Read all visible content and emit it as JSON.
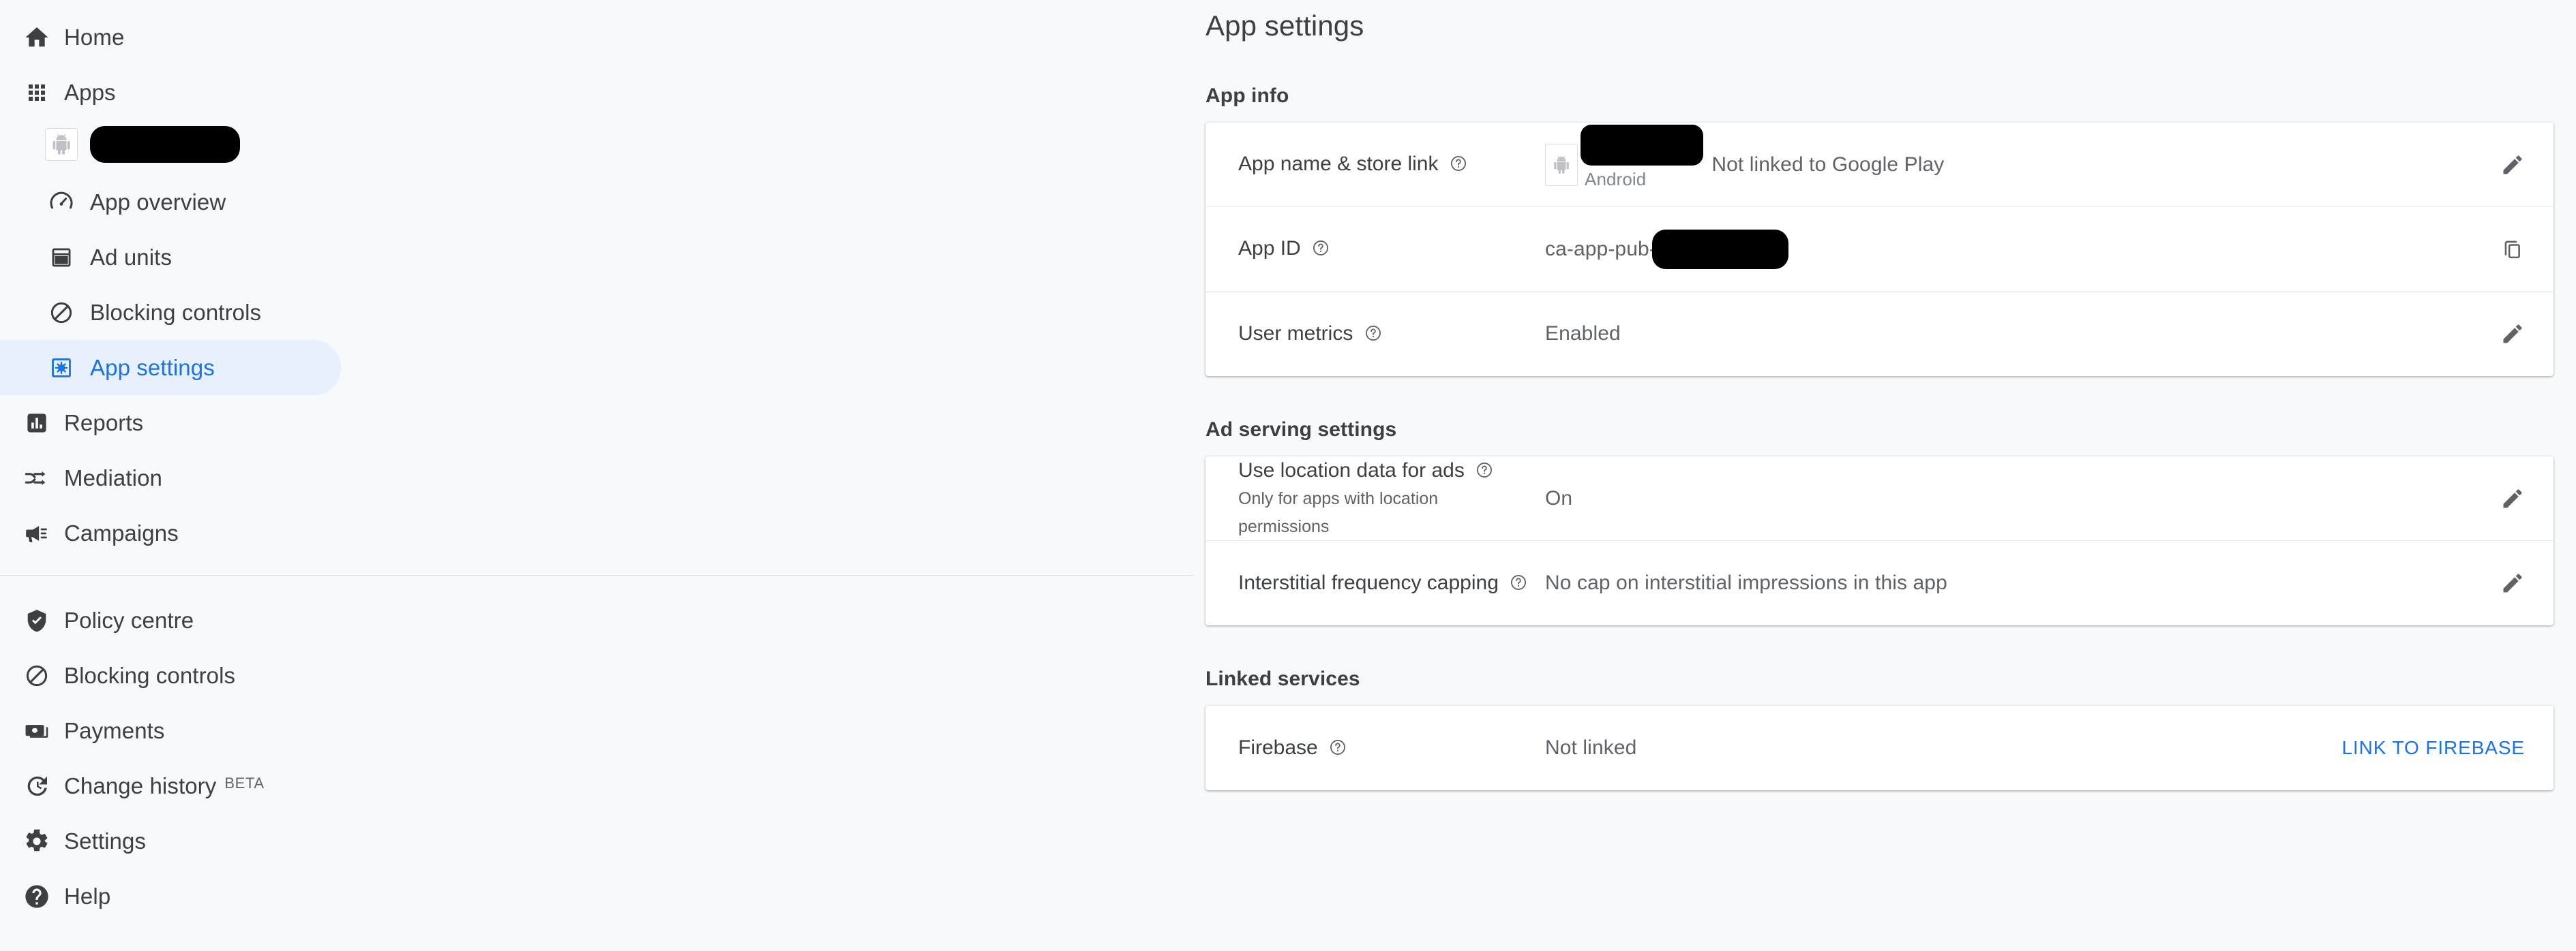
{
  "sidebar": {
    "primary": [
      {
        "label": "Home",
        "icon": "home-icon",
        "name": "sidebar-item-home"
      },
      {
        "label": "Apps",
        "icon": "apps-grid-icon",
        "name": "sidebar-item-apps"
      }
    ],
    "app_chip": {
      "icon": "android-robot-icon",
      "name_redacted": true
    },
    "app_sub_items": [
      {
        "label": "App overview",
        "icon": "speedometer-icon",
        "name": "sidebar-item-app-overview",
        "selected": false
      },
      {
        "label": "Ad units",
        "icon": "ad-unit-icon",
        "name": "sidebar-item-ad-units",
        "selected": false
      },
      {
        "label": "Blocking controls",
        "icon": "block-icon",
        "name": "sidebar-item-blocking-controls",
        "selected": false
      },
      {
        "label": "App settings",
        "icon": "app-settings-icon",
        "name": "sidebar-item-app-settings",
        "selected": true
      }
    ],
    "secondary": [
      {
        "label": "Reports",
        "icon": "bar-chart-icon",
        "name": "sidebar-item-reports"
      },
      {
        "label": "Mediation",
        "icon": "mediation-icon",
        "name": "sidebar-item-mediation"
      },
      {
        "label": "Campaigns",
        "icon": "megaphone-icon",
        "name": "sidebar-item-campaigns"
      }
    ],
    "tertiary": [
      {
        "label": "Policy centre",
        "icon": "shield-check-icon",
        "name": "sidebar-item-policy-centre",
        "badge": ""
      },
      {
        "label": "Blocking controls",
        "icon": "block-icon",
        "name": "sidebar-item-blocking-controls-global",
        "badge": ""
      },
      {
        "label": "Payments",
        "icon": "money-icon",
        "name": "sidebar-item-payments",
        "badge": ""
      },
      {
        "label": "Change history",
        "icon": "history-icon",
        "name": "sidebar-item-change-history",
        "badge": "BETA"
      },
      {
        "label": "Settings",
        "icon": "gear-icon",
        "name": "sidebar-item-settings",
        "badge": ""
      },
      {
        "label": "Help",
        "icon": "help-circle-icon",
        "name": "sidebar-item-help",
        "badge": ""
      }
    ]
  },
  "main": {
    "page_title": "App settings",
    "sections": {
      "app_info": {
        "heading": "App info",
        "rows": {
          "app_name": {
            "label": "App name & store link",
            "platform": "Android",
            "status": "Not linked to Google Play",
            "action_icon": "pencil-icon"
          },
          "app_id": {
            "label": "App ID",
            "value_prefix": "ca-app-pub-",
            "action_icon": "copy-icon"
          },
          "user_metrics": {
            "label": "User metrics",
            "value": "Enabled",
            "action_icon": "pencil-icon"
          }
        }
      },
      "ad_serving": {
        "heading": "Ad serving settings",
        "rows": {
          "location_data": {
            "label": "Use location data for ads",
            "sublabel": "Only for apps with location permissions",
            "value": "On",
            "action_icon": "pencil-icon"
          },
          "interstitial_capping": {
            "label": "Interstitial frequency capping",
            "value": "No cap on interstitial impressions in this app",
            "action_icon": "pencil-icon"
          }
        }
      },
      "linked_services": {
        "heading": "Linked services",
        "rows": {
          "firebase": {
            "label": "Firebase",
            "value": "Not linked",
            "action_label": "LINK TO FIREBASE"
          }
        }
      }
    }
  },
  "colors": {
    "accent": "#1a73e8",
    "selected_bg": "#e8f0fe",
    "page_bg": "#f8f9fa",
    "card_bg": "#ffffff",
    "text_primary": "#3c4043",
    "text_secondary": "#5f6368"
  }
}
